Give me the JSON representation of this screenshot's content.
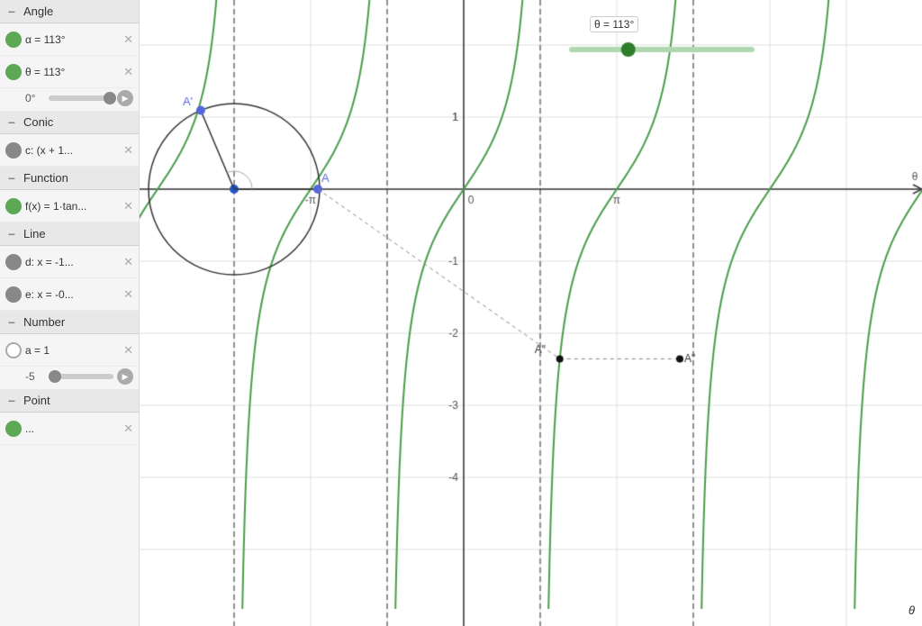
{
  "sidebar": {
    "sections": [
      {
        "id": "angle",
        "label": "Angle",
        "items": [
          {
            "id": "alpha",
            "dotClass": "dot-green",
            "text": "α = 113°",
            "hasX": true
          },
          {
            "id": "theta",
            "dotClass": "dot-green",
            "text": "θ = 113°",
            "hasX": true,
            "slider": {
              "label": "0°",
              "thumbPos": 95
            }
          }
        ]
      },
      {
        "id": "conic",
        "label": "Conic",
        "items": [
          {
            "id": "c",
            "dotClass": "dot-gray",
            "text": "c: (x + 1...)",
            "hasX": true
          }
        ]
      },
      {
        "id": "function",
        "label": "Function",
        "items": [
          {
            "id": "fx",
            "dotClass": "dot-green",
            "text": "f(x) = 1·tan...",
            "hasX": true
          }
        ]
      },
      {
        "id": "line",
        "label": "Line",
        "items": [
          {
            "id": "d",
            "dotClass": "dot-gray",
            "text": "d: x = -1...",
            "hasX": true
          },
          {
            "id": "e",
            "dotClass": "dot-gray",
            "text": "e: x = -0...",
            "hasX": true
          }
        ]
      },
      {
        "id": "number",
        "label": "Number",
        "items": [
          {
            "id": "a",
            "dotClass": "dot-white",
            "text": "a = 1",
            "hasX": true,
            "slider": {
              "label": "-5",
              "thumbPos": 5
            }
          }
        ]
      },
      {
        "id": "point",
        "label": "Point",
        "items": [
          {
            "id": "point1",
            "dotClass": "dot-green",
            "text": "...",
            "hasX": true
          }
        ]
      }
    ]
  },
  "canvas": {
    "thetaAnnotation": "θ = 113°",
    "axisLabels": {
      "theta": "θ",
      "numLabels": [
        "-π",
        "0",
        "π",
        "1",
        "-1",
        "-2",
        "-3",
        "-4"
      ]
    },
    "points": {
      "A": "A",
      "APrime": "A'",
      "ADoublePrime": "A\"",
      "ATriplePrime": "A\""
    }
  }
}
